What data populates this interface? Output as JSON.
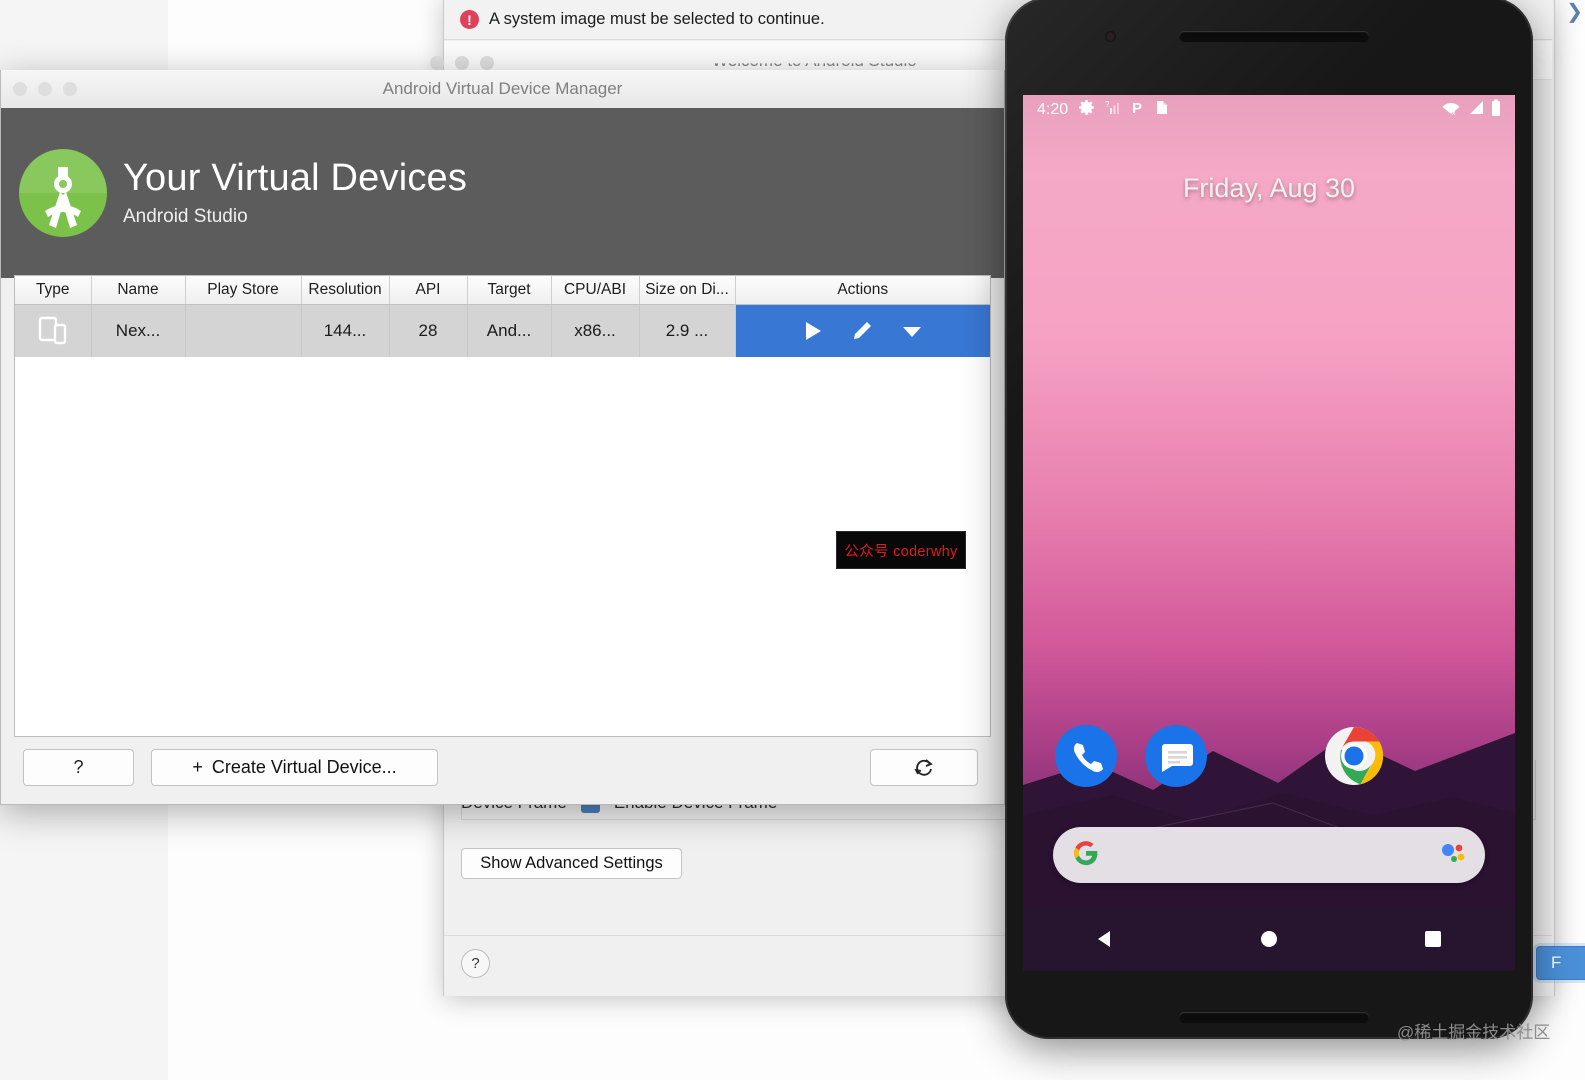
{
  "wizard": {
    "error_text": "A system image must be selected to continue.",
    "window_title": "Welcome to Android Studio",
    "device_frame_label": "Device Frame",
    "enable_device_frame_label": "Enable Device Frame",
    "advanced_settings_label": "Show Advanced Settings",
    "help_label": "?",
    "finish_label": "F",
    "close_icon": "close-icon"
  },
  "avd": {
    "window_title": "Android Virtual Device Manager",
    "heading": "Your Virtual Devices",
    "subheading": "Android Studio",
    "table": {
      "columns": [
        "Type",
        "Name",
        "Play Store",
        "Resolution",
        "API",
        "Target",
        "CPU/ABI",
        "Size on Di...",
        "Actions"
      ],
      "rows": [
        {
          "type_icon": "device-phone-tablet-icon",
          "name": "Nex...",
          "play_store": "",
          "resolution": "144...",
          "api": "28",
          "target": "And...",
          "cpu_abi": "x86...",
          "size_on_disk": "2.9 ...",
          "actions": [
            "run-icon",
            "edit-icon",
            "dropdown-icon"
          ],
          "selected": true
        }
      ]
    },
    "footer": {
      "help_label": "?",
      "create_label": "Create Virtual Device...",
      "create_plus": "+",
      "refresh_icon": "refresh-icon"
    }
  },
  "watermarks": {
    "tooltip_text": "公众号 coderwhy",
    "tooltip_color": "#e01b1b",
    "bottom_text": "@稀土掘金技术社区"
  },
  "phone": {
    "statusbar": {
      "time": "4:20",
      "left_icons": [
        "gear-icon",
        "signal-unknown-icon",
        "parking-p-icon",
        "sdcard-icon"
      ],
      "right_icons": [
        "wifi-disconnected-icon",
        "cell-signal-icon",
        "battery-full-icon"
      ]
    },
    "home": {
      "date": "Friday, Aug 30",
      "dock_apps": [
        "phone-app-icon",
        "messages-app-icon",
        "chrome-app-icon"
      ],
      "search_placeholder": "",
      "search_left_icon": "google-g-icon",
      "search_right_icon": "google-assistant-mic-icon"
    },
    "navbar": [
      "back-icon",
      "home-icon",
      "recents-icon"
    ]
  },
  "colors": {
    "accent_blue": "#3977d4",
    "android_green": "#7cc24a",
    "header_gray": "#5c5c5c",
    "error_red": "#e0415a"
  }
}
